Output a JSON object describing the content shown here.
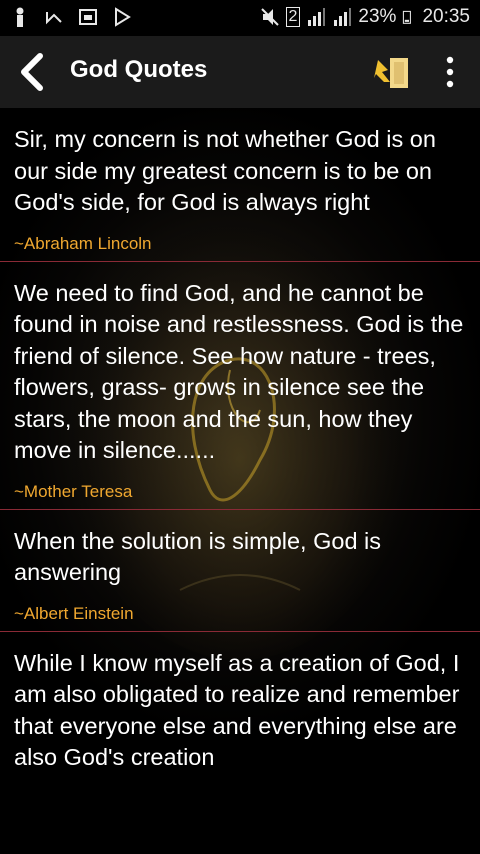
{
  "status_bar": {
    "sim": "2",
    "battery": "23%",
    "time": "20:35"
  },
  "app_bar": {
    "title": "God Quotes"
  },
  "quotes": [
    {
      "text": "Sir, my concern is not whether God is on our side my greatest concern is to be on God's side, for God is always right",
      "author": "~Abraham Lincoln"
    },
    {
      "text": "We need to find God, and he cannot be found in noise and restlessness. God is the friend of silence. See how nature - trees, flowers, grass- grows in silence see the stars, the moon and the sun, how they move in silence......",
      "author": "~Mother Teresa"
    },
    {
      "text": "When the solution is simple, God is answering",
      "author": "~Albert Einstein"
    },
    {
      "text": "While I know myself as a creation of God, I am also obligated to realize and remember that everyone else and everything else are also God's creation",
      "author": ""
    }
  ],
  "colors": {
    "author": "#f0a830",
    "divider": "#8a2a36",
    "app_bar": "#1b1b1b"
  }
}
